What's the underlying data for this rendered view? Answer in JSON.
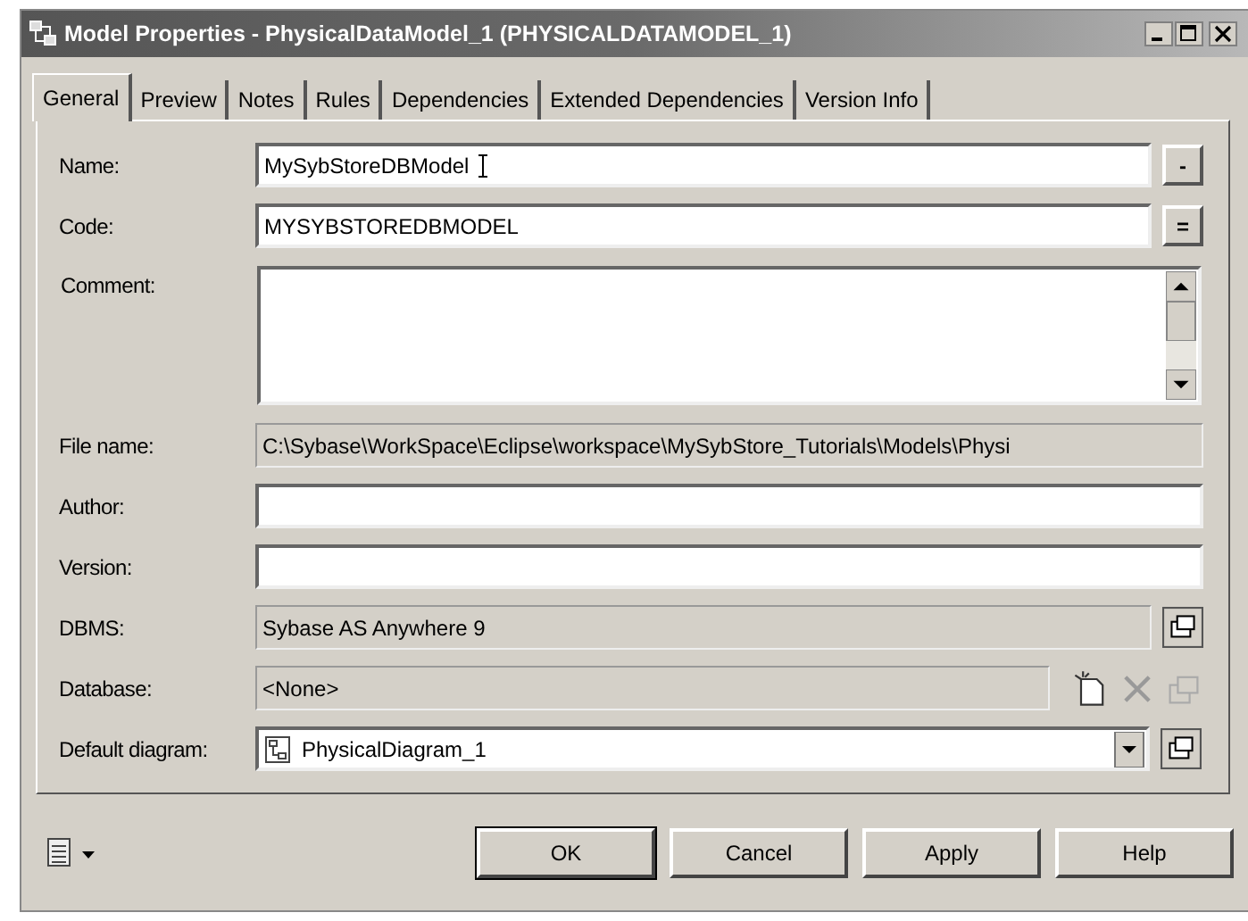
{
  "window": {
    "title": "Model Properties - PhysicalDataModel_1 (PHYSICALDATAMODEL_1)"
  },
  "tabs": [
    {
      "label": "General",
      "selected": true
    },
    {
      "label": "Preview",
      "selected": false
    },
    {
      "label": "Notes",
      "selected": false
    },
    {
      "label": "Rules",
      "selected": false
    },
    {
      "label": "Dependencies",
      "selected": false
    },
    {
      "label": "Extended Dependencies",
      "selected": false
    },
    {
      "label": "Version Info",
      "selected": false
    }
  ],
  "fields": [
    {
      "label": "Name:",
      "kind": "text",
      "value": "MySybStoreDBModel",
      "button": "-"
    },
    {
      "label": "Code:",
      "kind": "text",
      "value": "MYSYBSTOREDBMODEL",
      "button": "="
    },
    {
      "label": "Comment:",
      "kind": "memo"
    },
    {
      "label": "File name:",
      "kind": "readonly",
      "value": "C:\\Sybase\\WorkSpace\\Eclipse\\workspace\\MySybStore_Tutorials\\Models\\Physi"
    },
    {
      "label": "Author:",
      "kind": "text"
    },
    {
      "label": "Version:",
      "kind": "text"
    },
    {
      "label": "DBMS:",
      "kind": "readonly_props",
      "value": "Sybase AS Anywhere 9"
    },
    {
      "label": "Database:",
      "kind": "readonly_db",
      "value": "<None>"
    },
    {
      "label": "Default diagram:",
      "kind": "combo",
      "value": "PhysicalDiagram_1"
    }
  ],
  "buttons": [
    "OK",
    "Cancel",
    "Apply",
    "Help"
  ]
}
